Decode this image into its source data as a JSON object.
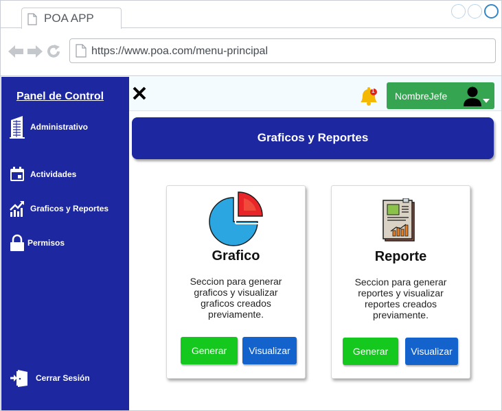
{
  "browser": {
    "tab_title": "POA APP",
    "url": "https://www.poa.com/menu-principal"
  },
  "sidebar": {
    "title": "Panel de Control",
    "items": [
      {
        "label": "Administrativo",
        "icon": "building-icon"
      },
      {
        "label": "Actividades",
        "icon": "calendar-icon"
      },
      {
        "label": "Graficos y Reportes",
        "icon": "chart-trend-icon"
      },
      {
        "label": "Permisos",
        "icon": "lock-icon"
      }
    ],
    "logout_label": "Cerrar Sesión"
  },
  "topbar": {
    "user_name": "NombreJefe",
    "notification_count": "1"
  },
  "main": {
    "banner_title": "Graficos y Reportes",
    "cards": [
      {
        "title": "Grafico",
        "description": "Seccion para generar graficos y visualizar graficos creados previamente.",
        "generate_label": "Generar",
        "view_label": "Visualizar"
      },
      {
        "title": "Reporte",
        "description": "Seccion para generar reportes y visualizar reportes creados previamente.",
        "generate_label": "Generar",
        "view_label": "Visualizar"
      }
    ]
  },
  "colors": {
    "sidebar_bg": "#1c27a0",
    "user_button": "#36a552",
    "generate_button": "#14c81e",
    "view_button": "#1463cc"
  }
}
